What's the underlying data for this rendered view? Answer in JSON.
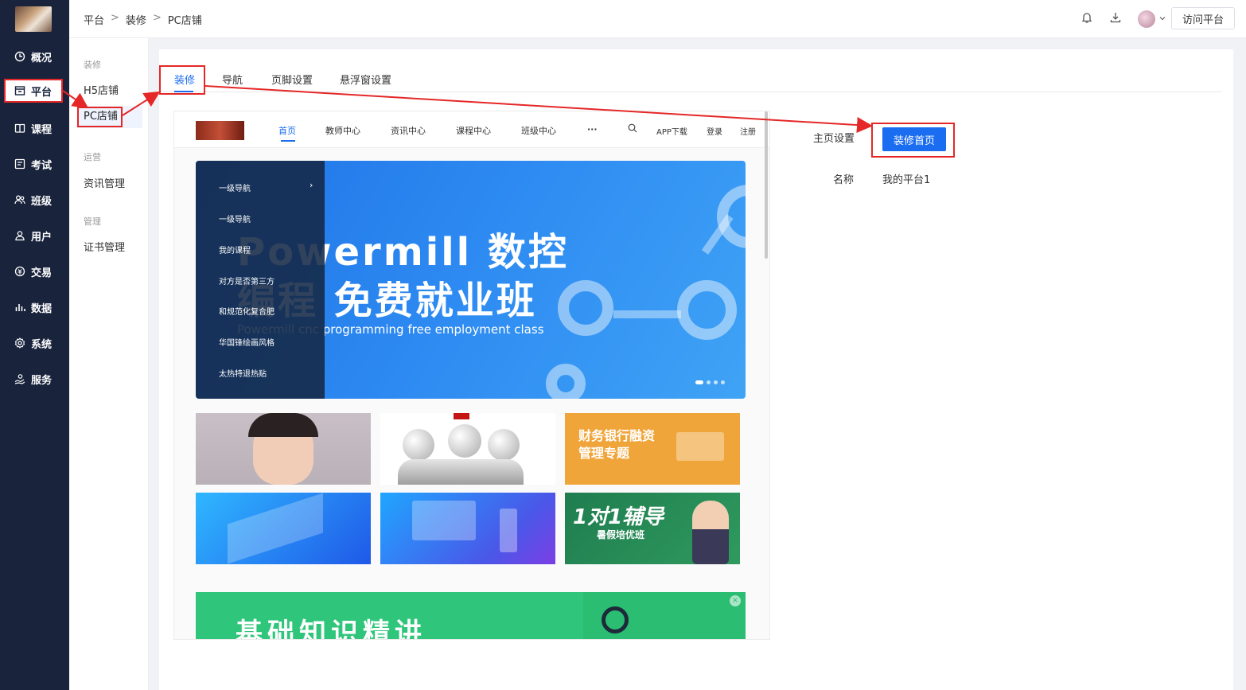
{
  "nav": {
    "items": [
      {
        "label": "概况",
        "icon": "clock-icon"
      },
      {
        "label": "平台",
        "icon": "store-icon"
      },
      {
        "label": "课程",
        "icon": "book-icon"
      },
      {
        "label": "考试",
        "icon": "exam-icon"
      },
      {
        "label": "班级",
        "icon": "group-icon"
      },
      {
        "label": "用户",
        "icon": "user-icon"
      },
      {
        "label": "交易",
        "icon": "trade-icon"
      },
      {
        "label": "数据",
        "icon": "chart-icon"
      },
      {
        "label": "系统",
        "icon": "gear-icon"
      },
      {
        "label": "服务",
        "icon": "service-icon"
      }
    ]
  },
  "subnav": {
    "group1": "装修",
    "h5": "H5店铺",
    "pc": "PC店铺",
    "group2": "运营",
    "news": "资讯管理",
    "group3": "管理",
    "cert": "证书管理"
  },
  "header": {
    "crumbs": [
      "平台",
      "装修",
      "PC店铺"
    ],
    "visit_label": "访问平台"
  },
  "tabs": [
    "装修",
    "导航",
    "页脚设置",
    "悬浮窗设置"
  ],
  "preview": {
    "nav": [
      "首页",
      "教师中心",
      "资讯中心",
      "课程中心",
      "班级中心",
      "···"
    ],
    "app_download": "APP下载",
    "login": "登录",
    "register": "注册",
    "menu": [
      "一级导航",
      "一级导航",
      "我的课程",
      "对方是否第三方",
      "和规范化复合肥",
      "华国锋绘画风格",
      "太热特退热贴"
    ],
    "banner": {
      "line1": "Powermill 数控",
      "line2": "编程 免费就业班",
      "line3": "Powermill cnc programming free employment class"
    },
    "tile_finance": "财务银行融资\n管理专题",
    "tile_tutor": "1对1辅导",
    "tile_tutor_sub": "暑假培优班",
    "bottom_text": "基础知识精讲"
  },
  "settings": {
    "home_label": "主页设置",
    "decorate_button": "装修首页",
    "name_label": "名称",
    "name_value": "我的平台1"
  },
  "colors": {
    "nav_bg": "#19233c",
    "accent": "#1a6cf0",
    "annotation": "#e52727"
  }
}
